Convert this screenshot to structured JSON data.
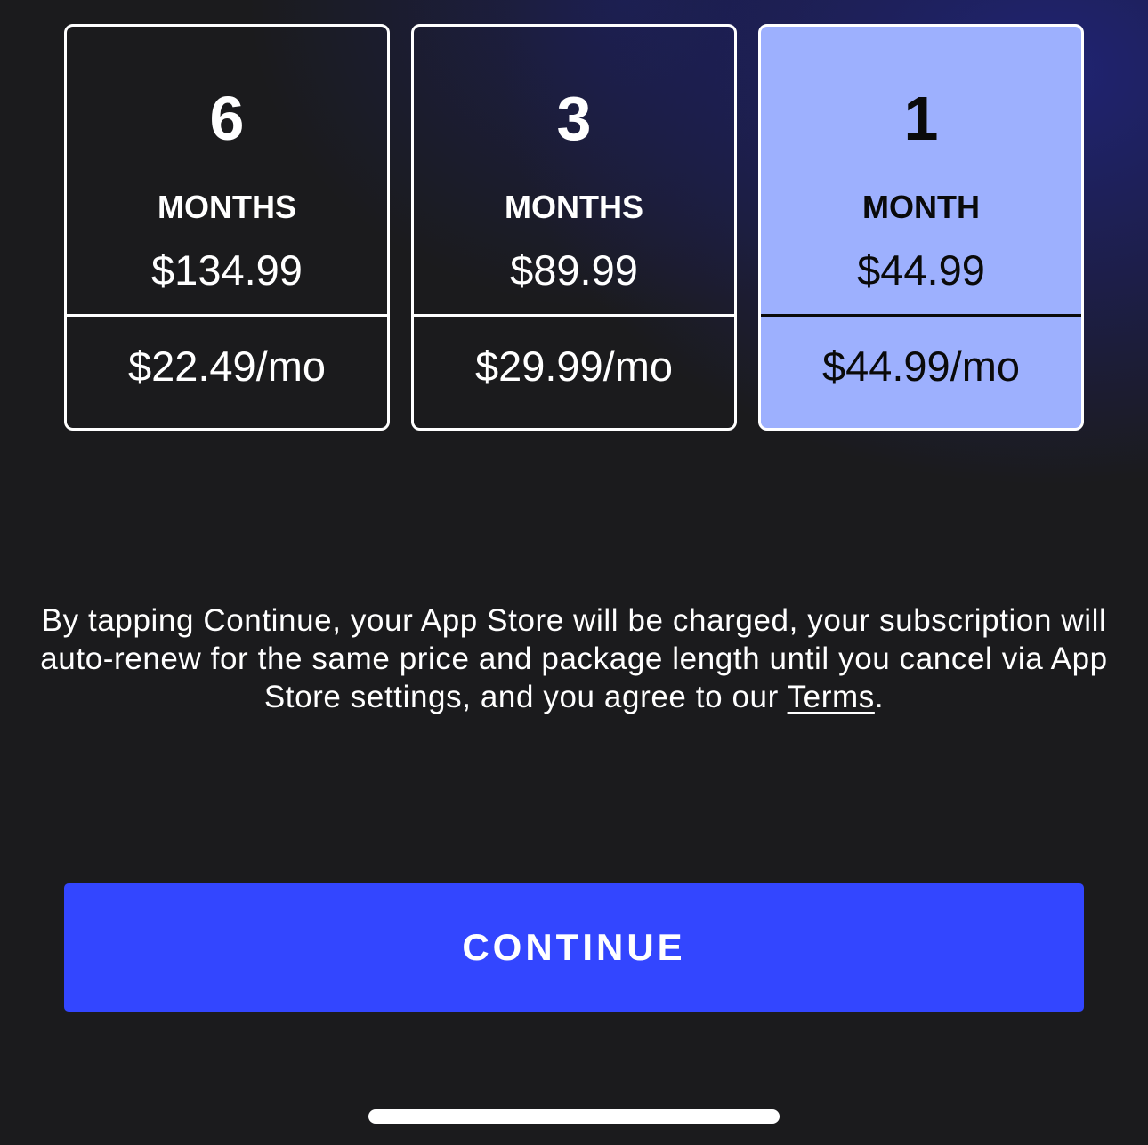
{
  "plans": [
    {
      "count": "6",
      "unit": "MONTHS",
      "price": "$134.99",
      "per_month": "$22.49/mo",
      "selected": false
    },
    {
      "count": "3",
      "unit": "MONTHS",
      "price": "$89.99",
      "per_month": "$29.99/mo",
      "selected": false
    },
    {
      "count": "1",
      "unit": "MONTH",
      "price": "$44.99",
      "per_month": "$44.99/mo",
      "selected": true
    }
  ],
  "legal": {
    "text": "By tapping Continue, your App Store will be charged, your subscription will auto-renew for the same price and package length until you cancel via App Store settings, and you agree to our ",
    "terms_link": "Terms",
    "end": "."
  },
  "continue_button": {
    "label": "CONTINUE"
  },
  "colors": {
    "background": "#1b1b1d",
    "selected_plan": "#9db0fe",
    "accent_button": "#3346ff"
  }
}
